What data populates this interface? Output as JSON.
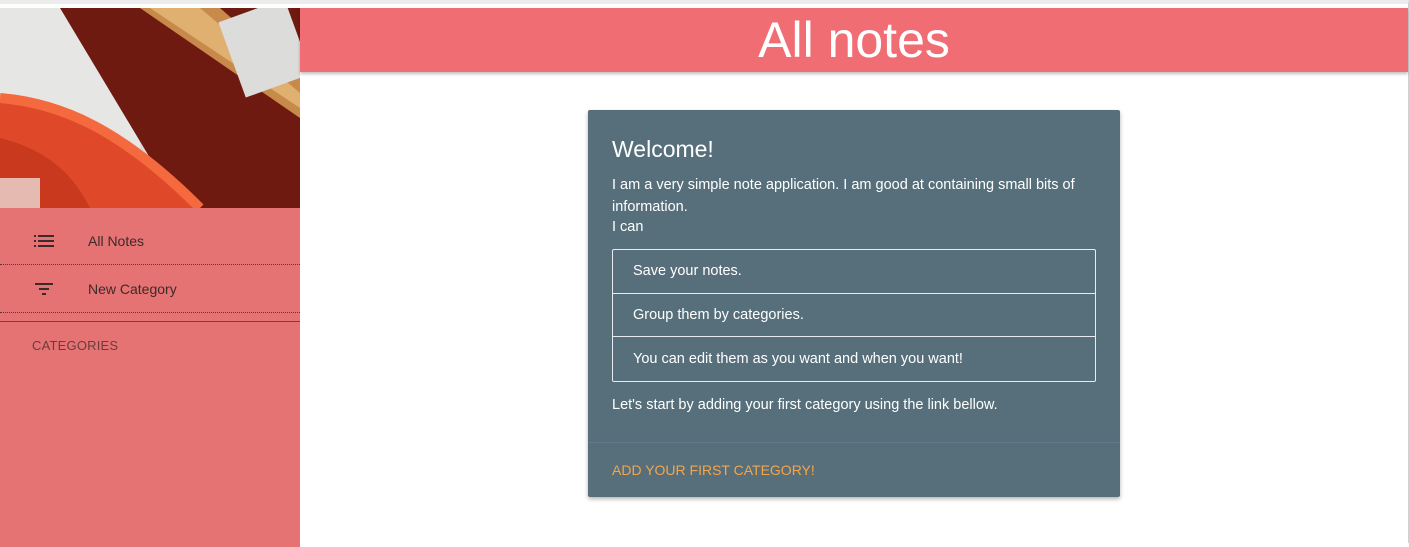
{
  "header": {
    "title": "All notes"
  },
  "sidebar": {
    "items": [
      {
        "label": "All Notes",
        "icon": "list-icon"
      },
      {
        "label": "New Category",
        "icon": "filter-icon"
      }
    ],
    "categories_header": "CATEGORIES"
  },
  "card": {
    "title": "Welcome!",
    "intro": "I am a very simple note application. I am good at containing small bits of information.",
    "ican": "I can",
    "features": [
      "Save your notes.",
      "Group them by categories.",
      "You can edit them as you want and when you want!"
    ],
    "outro": "Let's start by adding your first category using the link bellow.",
    "action_label": "ADD YOUR FIRST CATEGORY!"
  },
  "colors": {
    "sidebar_bg": "#e57373",
    "header_bg": "#f06d74",
    "card_bg": "#566f7b",
    "action_color": "#f5a54a"
  }
}
